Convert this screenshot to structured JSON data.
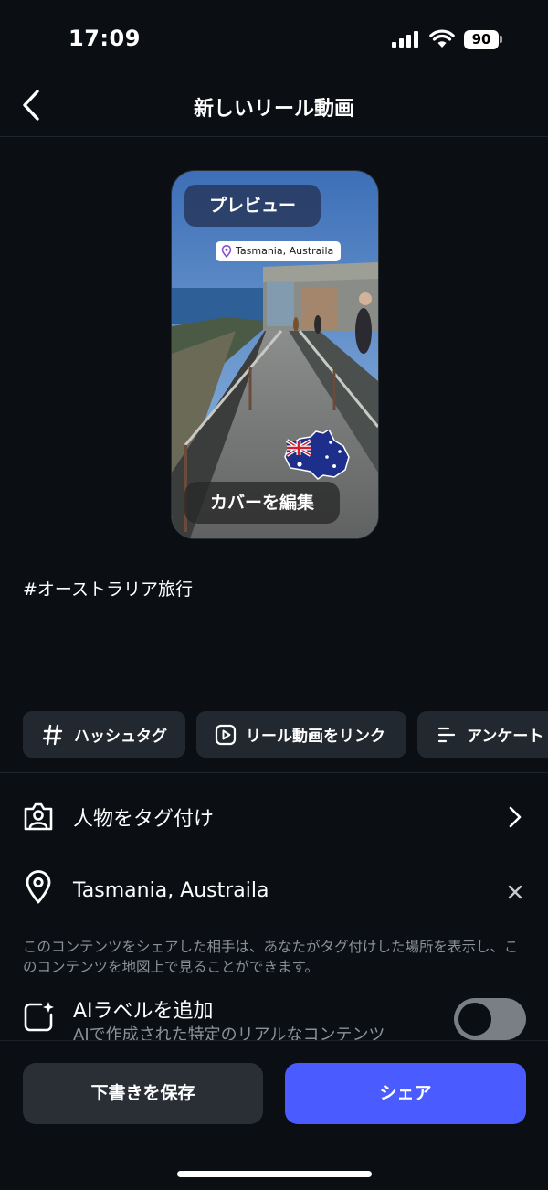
{
  "status_bar": {
    "time": "17:09",
    "battery": "90"
  },
  "header": {
    "title": "新しいリール動画"
  },
  "preview": {
    "preview_label": "プレビュー",
    "location_sticker": "Tasmania, Austraila",
    "cover_edit_label": "カバーを編集"
  },
  "caption": "#オーストラリア旅行",
  "chips": {
    "hashtag": "ハッシュタグ",
    "link_reel": "リール動画をリンク",
    "poll": "アンケート"
  },
  "rows": {
    "tag_people": "人物をタグ付け",
    "location": "Tasmania, Austraila",
    "location_note": "このコンテンツをシェアした相手は、あなたがタグ付けした場所を表示し、このコンテンツを地図上で見ることができます。",
    "ai_label": "AIラベルを追加",
    "ai_desc": "AIで作成された特定のリアルなコンテンツ",
    "ai_toggle_on": false
  },
  "actions": {
    "save_draft": "下書きを保存",
    "share": "シェア"
  },
  "colors": {
    "background": "#0b0f14",
    "share_button": "#4a5cff",
    "chip_bg": "#22282f"
  }
}
